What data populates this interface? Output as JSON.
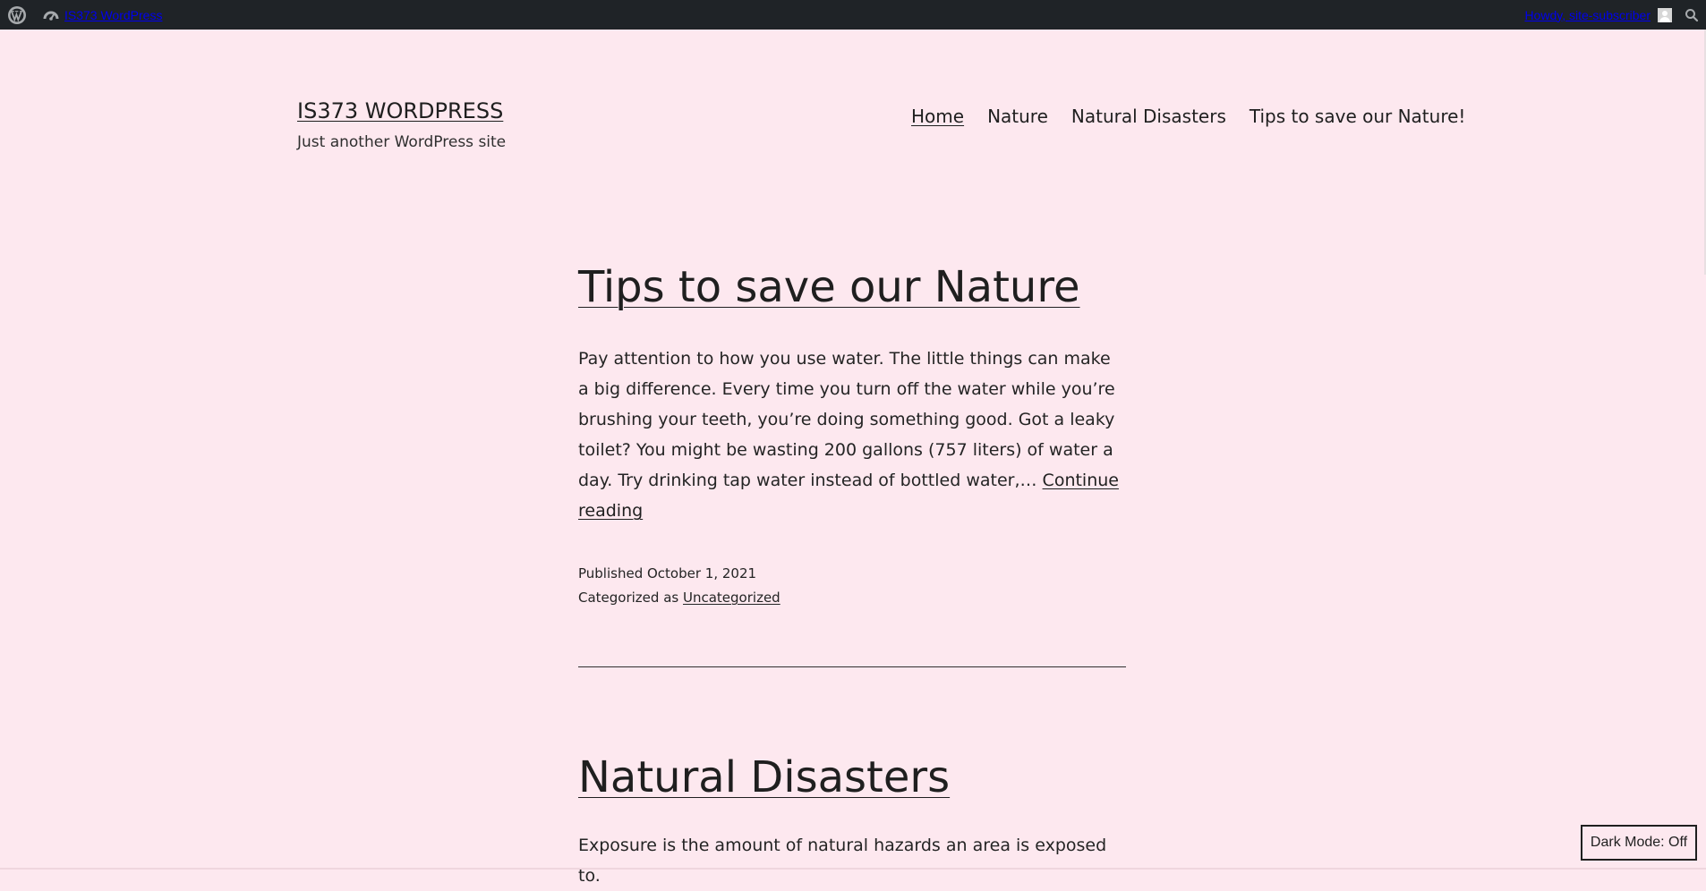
{
  "admin_bar": {
    "site_name": "IS373 WordPress",
    "howdy_text": "Howdy, site-subscriber",
    "icons": {
      "wp_logo": "wordpress-logo-icon",
      "site": "dashboard-icon",
      "avatar": "user-avatar-icon",
      "search": "search-icon"
    }
  },
  "header": {
    "site_title": "IS373 WORDPRESS",
    "site_description": "Just another WordPress site",
    "nav": [
      {
        "label": "Home"
      },
      {
        "label": "Nature"
      },
      {
        "label": "Natural Disasters"
      },
      {
        "label": "Tips to save our Nature!"
      }
    ]
  },
  "posts": [
    {
      "title": "Tips to save our Nature",
      "excerpt": "Pay attention to how you use water. The little things can make a big difference. Every time you turn off the water while you’re brushing your teeth, you’re doing something good. Got a leaky toilet? You might be wasting 200 gallons (757 liters) of water a day. Try drinking tap water instead of bottled water,…",
      "continue_label": "Continue reading",
      "published_label": "Published",
      "published_date": "October 1, 2021",
      "category_label": "Categorized as",
      "category": "Uncategorized"
    },
    {
      "title": "Natural Disasters",
      "excerpt": "Exposure is the amount of natural hazards an area is exposed to."
    }
  ],
  "dark_mode": {
    "label": "Dark Mode: Off"
  },
  "colors": {
    "background": "#fde8ef",
    "admin_bar": "#1f2327",
    "text": "#1f1f1f"
  }
}
